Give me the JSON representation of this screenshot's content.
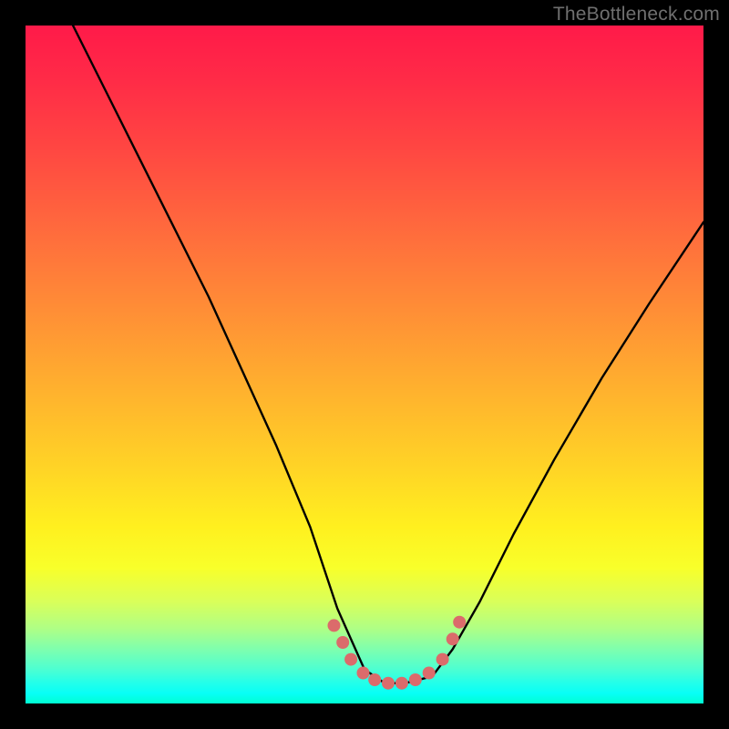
{
  "watermark": "TheBottleneck.com",
  "chart_data": {
    "type": "line",
    "title": "",
    "xlabel": "",
    "ylabel": "",
    "xlim": [
      0,
      1
    ],
    "ylim": [
      0,
      1
    ],
    "curve": {
      "comment": "V-shaped bottleneck curve; values are approximate fractions of plot area (0=left/bottom, 1=right/top). Flat minimum around x 0.50–0.60.",
      "x": [
        0.07,
        0.12,
        0.17,
        0.22,
        0.27,
        0.32,
        0.37,
        0.42,
        0.46,
        0.5,
        0.53,
        0.56,
        0.6,
        0.63,
        0.67,
        0.72,
        0.78,
        0.85,
        0.92,
        1.0
      ],
      "y": [
        1.0,
        0.9,
        0.8,
        0.7,
        0.6,
        0.49,
        0.38,
        0.26,
        0.14,
        0.05,
        0.03,
        0.03,
        0.04,
        0.08,
        0.15,
        0.25,
        0.36,
        0.48,
        0.59,
        0.71
      ]
    },
    "markers": {
      "comment": "Pink highlight dots near the trough of the curve",
      "points": [
        {
          "x": 0.455,
          "y": 0.115
        },
        {
          "x": 0.468,
          "y": 0.09
        },
        {
          "x": 0.48,
          "y": 0.065
        },
        {
          "x": 0.498,
          "y": 0.045
        },
        {
          "x": 0.515,
          "y": 0.035
        },
        {
          "x": 0.535,
          "y": 0.03
        },
        {
          "x": 0.555,
          "y": 0.03
        },
        {
          "x": 0.575,
          "y": 0.035
        },
        {
          "x": 0.595,
          "y": 0.045
        },
        {
          "x": 0.615,
          "y": 0.065
        },
        {
          "x": 0.63,
          "y": 0.095
        },
        {
          "x": 0.64,
          "y": 0.12
        }
      ]
    },
    "gradient_stops": [
      {
        "pos": 0.0,
        "color": "#ff1a49"
      },
      {
        "pos": 0.5,
        "color": "#ffb22e"
      },
      {
        "pos": 0.8,
        "color": "#f8ff2a"
      },
      {
        "pos": 1.0,
        "color": "#00ffd2"
      }
    ]
  }
}
